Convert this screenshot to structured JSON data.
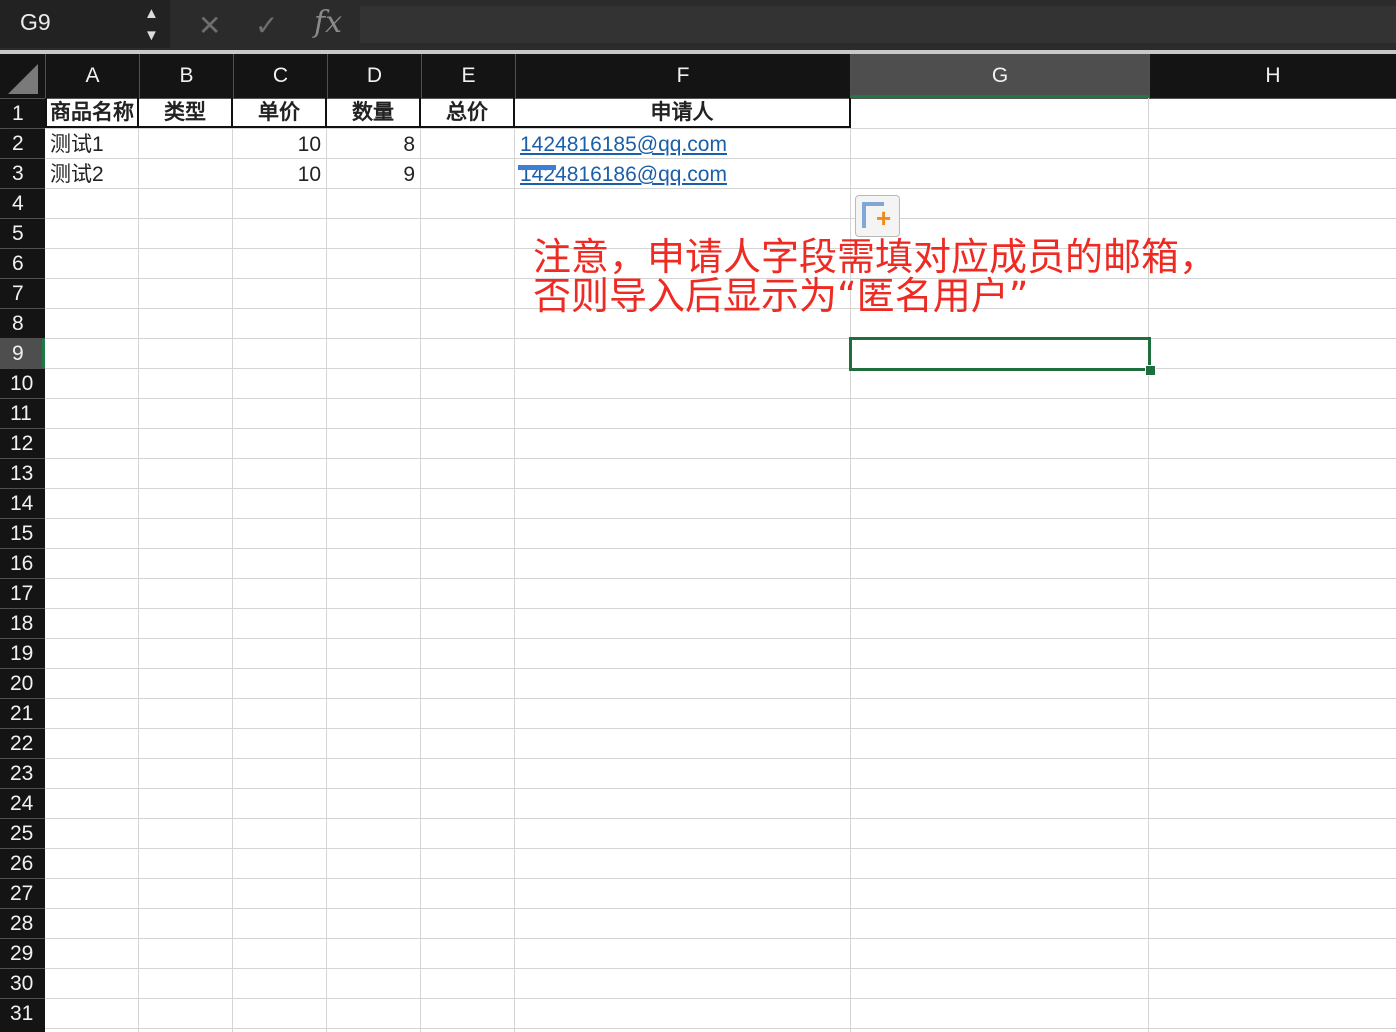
{
  "formula_bar": {
    "name_box": "G9",
    "cancel_icon": "✕",
    "confirm_icon": "✓",
    "fx_label": "fx",
    "formula": ""
  },
  "columns": [
    "A",
    "B",
    "C",
    "D",
    "E",
    "F",
    "G",
    "H"
  ],
  "selected_column": "G",
  "rows": [
    "1",
    "2",
    "3",
    "4",
    "5",
    "6",
    "7",
    "8",
    "9",
    "10",
    "11",
    "12",
    "13",
    "14",
    "15",
    "16",
    "17",
    "18",
    "19",
    "20",
    "21",
    "22",
    "23",
    "24",
    "25",
    "26",
    "27",
    "28",
    "29",
    "30",
    "31"
  ],
  "selected_row": "9",
  "sheet": {
    "header": [
      "商品名称",
      "类型",
      "单价",
      "数量",
      "总价",
      "申请人"
    ],
    "data": [
      {
        "name": "测试1",
        "type": "",
        "price": "10",
        "qty": "8",
        "total": "",
        "applicant": "1424816185@qq.com"
      },
      {
        "name": "测试2",
        "type": "",
        "price": "10",
        "qty": "9",
        "total": "",
        "applicant": "1424816186@qq.com"
      }
    ]
  },
  "note": {
    "line1": "注意，申请人字段需填对应成员的邮箱，",
    "line2": "否则导入后显示为“匿名用户”",
    "color": "#ee2a22"
  },
  "icons": {
    "paste_options": "paste-options-icon",
    "stepper": "stepper-icon"
  },
  "colors": {
    "selection": "#1f6f3e",
    "link": "#1b5fa8"
  }
}
